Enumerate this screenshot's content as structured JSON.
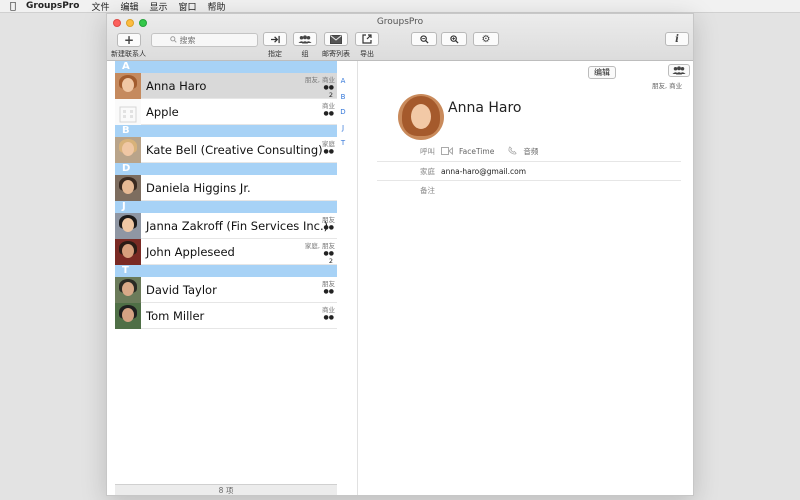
{
  "menubar": {
    "app_name": "GroupsPro",
    "items": [
      "文件",
      "编辑",
      "显示",
      "窗口",
      "帮助"
    ]
  },
  "window": {
    "title": "GroupsPro"
  },
  "toolbar": {
    "new_contact_label": "新建联系人",
    "search_placeholder": "搜索",
    "assign_label": "指定",
    "group_label": "组",
    "mailing_list_label": "邮寄列表",
    "export_label": "导出"
  },
  "sections": [
    {
      "letter": "A",
      "contacts": [
        {
          "name": "Anna Haro",
          "tags": "朋友, 商业",
          "count": "2",
          "selected": true
        },
        {
          "name": "Apple",
          "tags": "商业",
          "count": ""
        }
      ]
    },
    {
      "letter": "B",
      "contacts": [
        {
          "name": "Kate Bell (Creative Consulting)",
          "tags": "家庭",
          "count": ""
        }
      ]
    },
    {
      "letter": "D",
      "contacts": [
        {
          "name": "Daniela Higgins Jr.",
          "tags": "",
          "count": ""
        }
      ]
    },
    {
      "letter": "J",
      "contacts": [
        {
          "name": "Janna Zakroff (Fin Services Inc.)",
          "tags": "朋友",
          "count": ""
        },
        {
          "name": "John Appleseed",
          "tags": "家庭, 朋友",
          "count": "2"
        }
      ]
    },
    {
      "letter": "T",
      "contacts": [
        {
          "name": "David Taylor",
          "tags": "朋友",
          "count": ""
        },
        {
          "name": "Tom Miller",
          "tags": "商业",
          "count": ""
        }
      ]
    }
  ],
  "index_letters": [
    "A",
    "B",
    "D",
    "J",
    "T"
  ],
  "footer": {
    "count_text": "8 项"
  },
  "detail": {
    "edit_label": "编辑",
    "groups_text": "朋友, 商业",
    "name": "Anna Haro",
    "call_label": "呼叫",
    "facetime_label": "FaceTime",
    "audio_label": "音频",
    "home_label": "家庭",
    "email": "anna-haro@gmail.com",
    "notes_label": "备注"
  },
  "colors": {
    "section_header": "#a7d2f6",
    "index_letter": "#3477d9",
    "selected_row": "#d9d9d9"
  }
}
